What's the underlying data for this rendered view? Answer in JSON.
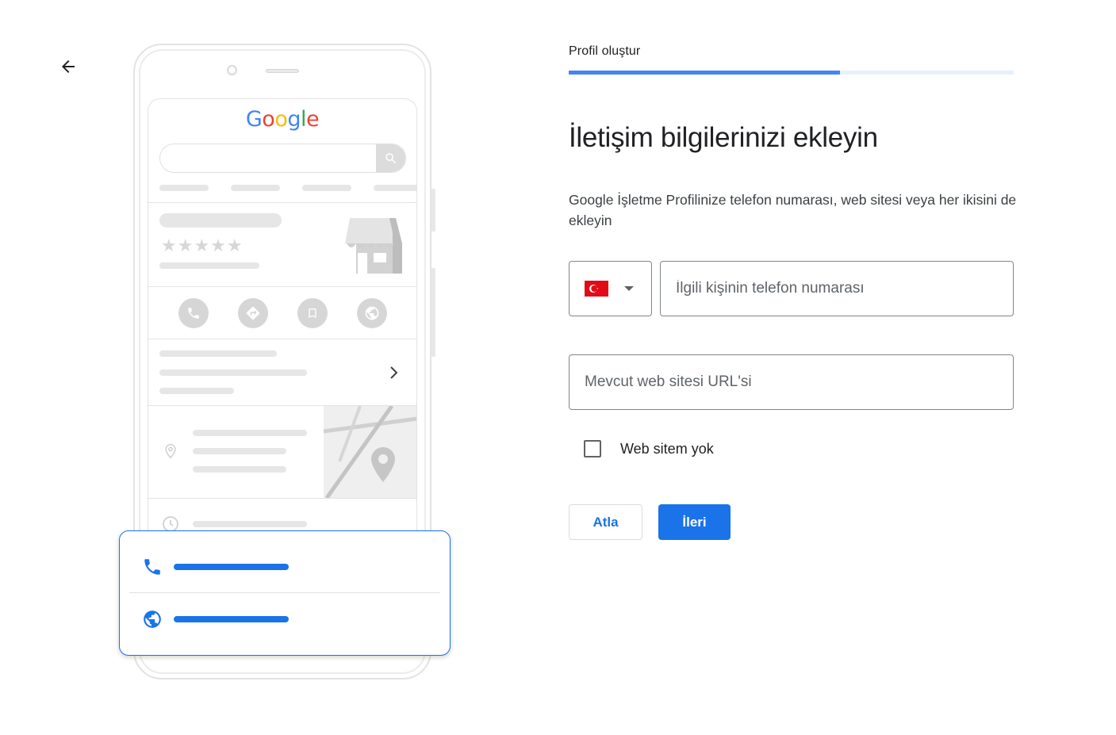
{
  "nav": {
    "back_icon": "arrow-back-icon"
  },
  "illustration": {
    "logo_text": "Google",
    "logo_colors": [
      "#4285f4",
      "#ea4335",
      "#fbbc05",
      "#4285f4",
      "#34a853",
      "#ea4335"
    ],
    "stars": "★★★★★",
    "action_icons": [
      "phone-icon",
      "directions-icon",
      "bookmark-icon",
      "globe-icon"
    ],
    "contact_icons": [
      "phone-icon",
      "globe-icon"
    ]
  },
  "form": {
    "step_label": "Profil oluştur",
    "progress": 0.61,
    "title": "İletişim bilgilerinizi ekleyin",
    "subtitle": "Google İşletme Profilinize telefon numarası, web sitesi veya her ikisini de ekleyin",
    "country": {
      "flag": "turkey-flag-icon",
      "flag_color": "#e30a17"
    },
    "phone_placeholder": "İlgili kişinin telefon numarası",
    "website_placeholder": "Mevcut web sitesi URL'si",
    "no_website_label": "Web sitem yok",
    "skip_label": "Atla",
    "next_label": "İleri"
  },
  "colors": {
    "accent": "#1a73e8",
    "progress": "#4285f4",
    "track": "#e8f0fe"
  }
}
